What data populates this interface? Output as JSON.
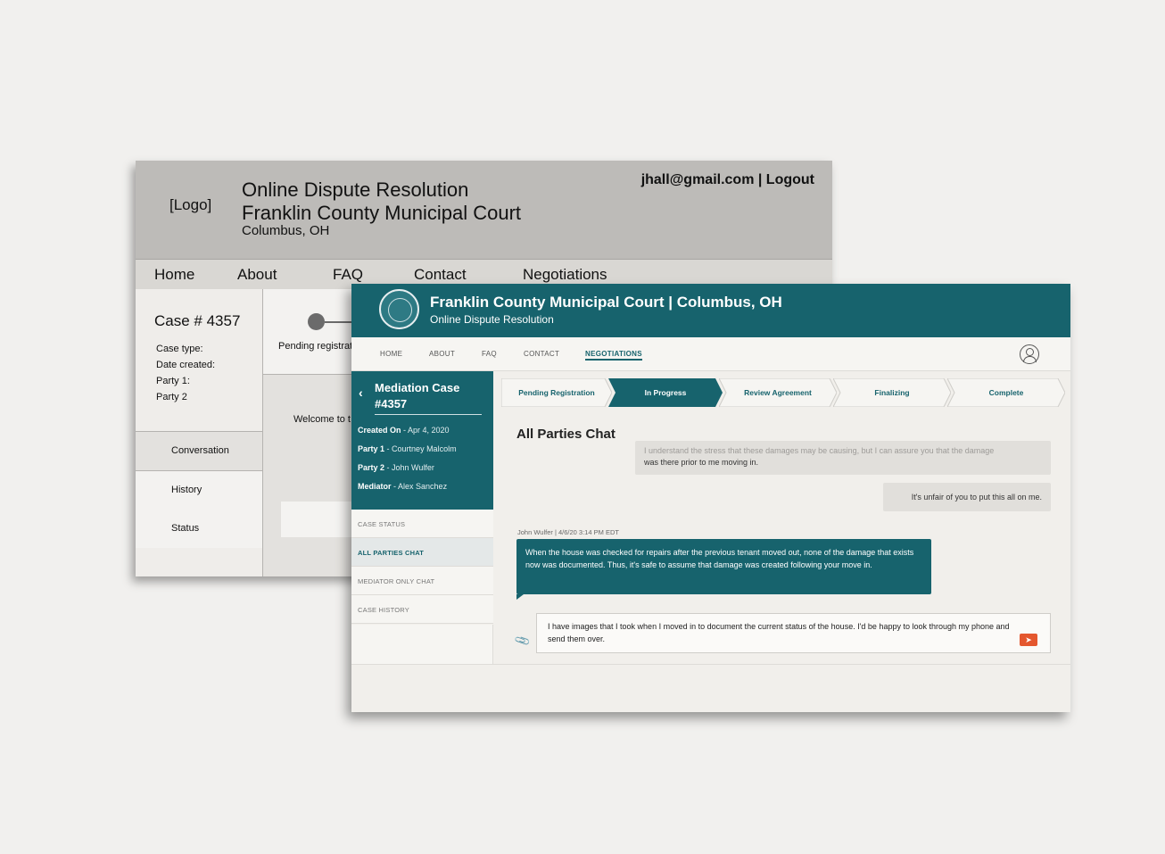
{
  "wireframe": {
    "logo": "[Logo]",
    "title_line1": "Online Dispute Resolution",
    "title_line2": "Franklin County Municipal Court",
    "title_line3": "Columbus, OH",
    "user_links": "jhall@gmail.com | Logout",
    "nav": [
      "Home",
      "About",
      "FAQ",
      "Contact",
      "Negotiations"
    ],
    "case_title": "Case # 4357",
    "case_fields": [
      "Case type:",
      "Date created:",
      "Party 1:",
      "Party 2"
    ],
    "sidebar": [
      "Conversation",
      "History",
      "Status"
    ],
    "progress_label": "Pending registrat",
    "welcome": "Welcome to t"
  },
  "hifi": {
    "header_title": "Franklin County Municipal Court | Columbus, OH",
    "header_subtitle": "Online Dispute Resolution",
    "nav": [
      "HOME",
      "ABOUT",
      "FAQ",
      "CONTACT",
      "NEGOTIATIONS"
    ],
    "active_nav": "NEGOTIATIONS",
    "case_title": "Mediation Case #4357",
    "meta": [
      {
        "label": "Created On",
        "value": "- Apr 4, 2020"
      },
      {
        "label": "Party 1",
        "value": "- Courtney Malcolm"
      },
      {
        "label": "Party 2",
        "value": "- John Wulfer"
      },
      {
        "label": "Mediator",
        "value": "- Alex Sanchez"
      }
    ],
    "side_nav": [
      "CASE STATUS",
      "ALL PARTIES CHAT",
      "MEDIATOR ONLY CHAT",
      "CASE HISTORY"
    ],
    "active_side": "ALL PARTIES CHAT",
    "steps": [
      "Pending Registration",
      "In Progress",
      "Review Agreement",
      "Finalizing",
      "Complete"
    ],
    "active_step": "In Progress",
    "chat_title": "All Parties Chat",
    "messages": {
      "faded": "I understand the stress that these damages may be causing, but I can assure you that the damage",
      "msg1": "was there prior to me moving in.",
      "msg2": "It's unfair of you to put this all on me.",
      "msg3_meta": "John Wulfer | 4/6/20 3:14 PM EDT",
      "msg3": "When the house was checked for repairs after the previous tenant moved out, none of the damage that exists now was documented. Thus, it's safe to assume that damage was created following your move in."
    },
    "input_value": "I have images that I took when I moved in to document the current status of the house. I'd be happy to look through my phone and send them over.",
    "send_label": "➤",
    "attach_icon": "📎",
    "colors": {
      "teal": "#17636d",
      "send": "#e4572e"
    }
  }
}
